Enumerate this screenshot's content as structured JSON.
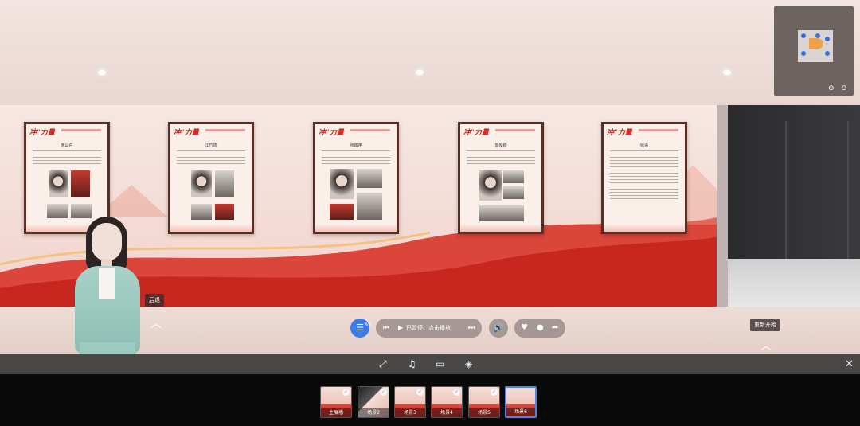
{
  "scene": {
    "posters": [
      {
        "header": "冲\"力量",
        "title": "朱山舟"
      },
      {
        "header": "冲\"力量",
        "title": "江竹筠"
      },
      {
        "header": "冲\"力量",
        "title": "张露萍"
      },
      {
        "header": "冲\"力量",
        "title": "郭俊卿"
      },
      {
        "header": "冲\"力量",
        "title": "结语"
      }
    ],
    "back_label": "后退",
    "restart_label": "重新开始"
  },
  "player": {
    "menu_badge": "4/6",
    "status_text": "已暂停，点击播放"
  },
  "scenes": {
    "items": [
      {
        "label": "主展墙",
        "active": false
      },
      {
        "label": "场景2",
        "active": false
      },
      {
        "label": "场景3",
        "active": false
      },
      {
        "label": "场景4",
        "active": false
      },
      {
        "label": "场景5",
        "active": false
      },
      {
        "label": "场景6",
        "active": true
      }
    ]
  },
  "icons": {
    "menu": "list-icon",
    "prev": "skip-back-icon",
    "play": "play-icon",
    "next": "skip-forward-icon",
    "volume": "volume-icon",
    "like": "heart-icon",
    "comment": "comment-icon",
    "share": "share-icon",
    "fullscreen": "expand-icon",
    "music": "music-icon",
    "vr": "vr-glasses-icon",
    "gyro": "gyroscope-icon",
    "close": "close-icon",
    "zoom_in": "zoom-in-icon",
    "zoom_out": "zoom-out-icon"
  },
  "colors": {
    "accent": "#3d7be6",
    "poster_frame": "#5a2e22",
    "wall_red": "#d8352a"
  }
}
